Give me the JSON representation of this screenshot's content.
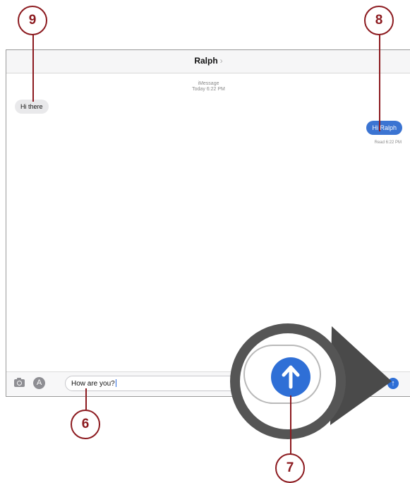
{
  "header": {
    "contact_name": "Ralph",
    "chevron": "›"
  },
  "thread": {
    "service": "iMessage",
    "timestamp": "Today 6:22 PM",
    "messages": [
      {
        "direction": "incoming",
        "text": "Hi there"
      },
      {
        "direction": "outgoing",
        "text": "Hi Ralph",
        "status": "Read 6:22 PM"
      }
    ]
  },
  "composer": {
    "text": "How are you?",
    "camera_icon": "camera-icon",
    "appstore_icon": "app-store-icon",
    "send_icon": "send-arrow-icon"
  },
  "callouts": [
    "9",
    "8",
    "6",
    "7"
  ],
  "colors": {
    "callout": "#8c1a1f",
    "outgoing_bubble": "#3b74d2",
    "send_button": "#2f6fd6",
    "incoming_bubble": "#e9e9eb"
  }
}
